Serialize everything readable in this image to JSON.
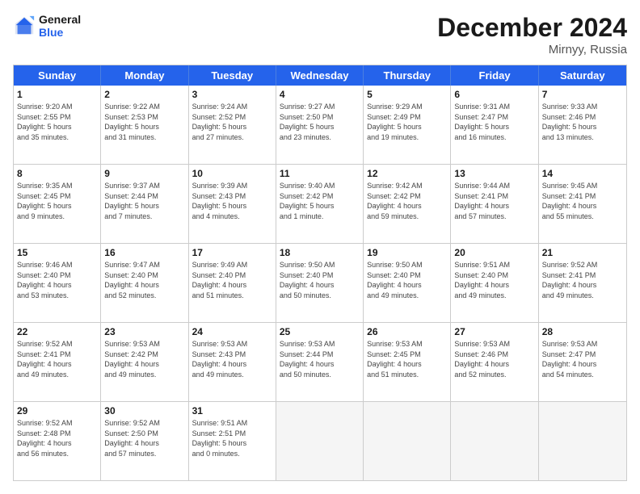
{
  "logo": {
    "general": "General",
    "blue": "Blue"
  },
  "title": "December 2024",
  "location": "Mirnyy, Russia",
  "weekdays": [
    "Sunday",
    "Monday",
    "Tuesday",
    "Wednesday",
    "Thursday",
    "Friday",
    "Saturday"
  ],
  "weeks": [
    [
      {
        "day": "1",
        "lines": [
          "Sunrise: 9:20 AM",
          "Sunset: 2:55 PM",
          "Daylight: 5 hours",
          "and 35 minutes."
        ]
      },
      {
        "day": "2",
        "lines": [
          "Sunrise: 9:22 AM",
          "Sunset: 2:53 PM",
          "Daylight: 5 hours",
          "and 31 minutes."
        ]
      },
      {
        "day": "3",
        "lines": [
          "Sunrise: 9:24 AM",
          "Sunset: 2:52 PM",
          "Daylight: 5 hours",
          "and 27 minutes."
        ]
      },
      {
        "day": "4",
        "lines": [
          "Sunrise: 9:27 AM",
          "Sunset: 2:50 PM",
          "Daylight: 5 hours",
          "and 23 minutes."
        ]
      },
      {
        "day": "5",
        "lines": [
          "Sunrise: 9:29 AM",
          "Sunset: 2:49 PM",
          "Daylight: 5 hours",
          "and 19 minutes."
        ]
      },
      {
        "day": "6",
        "lines": [
          "Sunrise: 9:31 AM",
          "Sunset: 2:47 PM",
          "Daylight: 5 hours",
          "and 16 minutes."
        ]
      },
      {
        "day": "7",
        "lines": [
          "Sunrise: 9:33 AM",
          "Sunset: 2:46 PM",
          "Daylight: 5 hours",
          "and 13 minutes."
        ]
      }
    ],
    [
      {
        "day": "8",
        "lines": [
          "Sunrise: 9:35 AM",
          "Sunset: 2:45 PM",
          "Daylight: 5 hours",
          "and 9 minutes."
        ]
      },
      {
        "day": "9",
        "lines": [
          "Sunrise: 9:37 AM",
          "Sunset: 2:44 PM",
          "Daylight: 5 hours",
          "and 7 minutes."
        ]
      },
      {
        "day": "10",
        "lines": [
          "Sunrise: 9:39 AM",
          "Sunset: 2:43 PM",
          "Daylight: 5 hours",
          "and 4 minutes."
        ]
      },
      {
        "day": "11",
        "lines": [
          "Sunrise: 9:40 AM",
          "Sunset: 2:42 PM",
          "Daylight: 5 hours",
          "and 1 minute."
        ]
      },
      {
        "day": "12",
        "lines": [
          "Sunrise: 9:42 AM",
          "Sunset: 2:42 PM",
          "Daylight: 4 hours",
          "and 59 minutes."
        ]
      },
      {
        "day": "13",
        "lines": [
          "Sunrise: 9:44 AM",
          "Sunset: 2:41 PM",
          "Daylight: 4 hours",
          "and 57 minutes."
        ]
      },
      {
        "day": "14",
        "lines": [
          "Sunrise: 9:45 AM",
          "Sunset: 2:41 PM",
          "Daylight: 4 hours",
          "and 55 minutes."
        ]
      }
    ],
    [
      {
        "day": "15",
        "lines": [
          "Sunrise: 9:46 AM",
          "Sunset: 2:40 PM",
          "Daylight: 4 hours",
          "and 53 minutes."
        ]
      },
      {
        "day": "16",
        "lines": [
          "Sunrise: 9:47 AM",
          "Sunset: 2:40 PM",
          "Daylight: 4 hours",
          "and 52 minutes."
        ]
      },
      {
        "day": "17",
        "lines": [
          "Sunrise: 9:49 AM",
          "Sunset: 2:40 PM",
          "Daylight: 4 hours",
          "and 51 minutes."
        ]
      },
      {
        "day": "18",
        "lines": [
          "Sunrise: 9:50 AM",
          "Sunset: 2:40 PM",
          "Daylight: 4 hours",
          "and 50 minutes."
        ]
      },
      {
        "day": "19",
        "lines": [
          "Sunrise: 9:50 AM",
          "Sunset: 2:40 PM",
          "Daylight: 4 hours",
          "and 49 minutes."
        ]
      },
      {
        "day": "20",
        "lines": [
          "Sunrise: 9:51 AM",
          "Sunset: 2:40 PM",
          "Daylight: 4 hours",
          "and 49 minutes."
        ]
      },
      {
        "day": "21",
        "lines": [
          "Sunrise: 9:52 AM",
          "Sunset: 2:41 PM",
          "Daylight: 4 hours",
          "and 49 minutes."
        ]
      }
    ],
    [
      {
        "day": "22",
        "lines": [
          "Sunrise: 9:52 AM",
          "Sunset: 2:41 PM",
          "Daylight: 4 hours",
          "and 49 minutes."
        ]
      },
      {
        "day": "23",
        "lines": [
          "Sunrise: 9:53 AM",
          "Sunset: 2:42 PM",
          "Daylight: 4 hours",
          "and 49 minutes."
        ]
      },
      {
        "day": "24",
        "lines": [
          "Sunrise: 9:53 AM",
          "Sunset: 2:43 PM",
          "Daylight: 4 hours",
          "and 49 minutes."
        ]
      },
      {
        "day": "25",
        "lines": [
          "Sunrise: 9:53 AM",
          "Sunset: 2:44 PM",
          "Daylight: 4 hours",
          "and 50 minutes."
        ]
      },
      {
        "day": "26",
        "lines": [
          "Sunrise: 9:53 AM",
          "Sunset: 2:45 PM",
          "Daylight: 4 hours",
          "and 51 minutes."
        ]
      },
      {
        "day": "27",
        "lines": [
          "Sunrise: 9:53 AM",
          "Sunset: 2:46 PM",
          "Daylight: 4 hours",
          "and 52 minutes."
        ]
      },
      {
        "day": "28",
        "lines": [
          "Sunrise: 9:53 AM",
          "Sunset: 2:47 PM",
          "Daylight: 4 hours",
          "and 54 minutes."
        ]
      }
    ],
    [
      {
        "day": "29",
        "lines": [
          "Sunrise: 9:52 AM",
          "Sunset: 2:48 PM",
          "Daylight: 4 hours",
          "and 56 minutes."
        ]
      },
      {
        "day": "30",
        "lines": [
          "Sunrise: 9:52 AM",
          "Sunset: 2:50 PM",
          "Daylight: 4 hours",
          "and 57 minutes."
        ]
      },
      {
        "day": "31",
        "lines": [
          "Sunrise: 9:51 AM",
          "Sunset: 2:51 PM",
          "Daylight: 5 hours",
          "and 0 minutes."
        ]
      },
      {
        "day": "",
        "lines": []
      },
      {
        "day": "",
        "lines": []
      },
      {
        "day": "",
        "lines": []
      },
      {
        "day": "",
        "lines": []
      }
    ]
  ]
}
